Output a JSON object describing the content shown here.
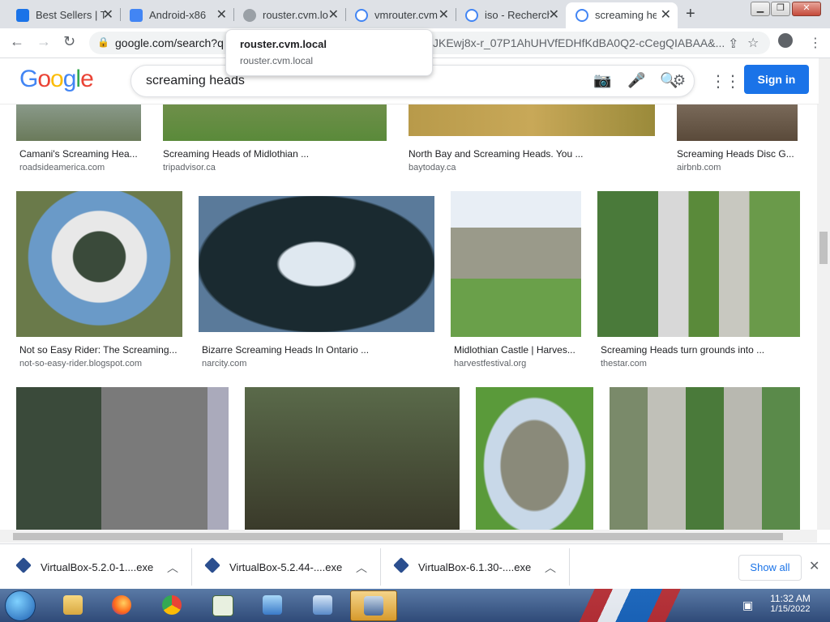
{
  "browser": {
    "tabs": [
      {
        "title": "Best Sellers | T",
        "favicon_color": "#1a73e8"
      },
      {
        "title": "Android-x86",
        "favicon_color": "#4285f4"
      },
      {
        "title": "rouster.cvm.lo",
        "favicon_color": "#9aa0a6"
      },
      {
        "title": "vmrouter.cvm",
        "favicon_color": "#4285f4"
      },
      {
        "title": "iso - Recherch",
        "favicon_color": "#4285f4"
      },
      {
        "title": "screaming he",
        "favicon_color": "#4285f4",
        "active": true
      }
    ],
    "url": "google.com/search?q",
    "url_tail": "JKEwj8x-r_07P1AhUHVfEDHfKdBA0Q2-cCegQIABAA&...",
    "tooltip": {
      "title": "rouster.cvm.local",
      "subtitle": "rouster.cvm.local"
    }
  },
  "google": {
    "logo": "Google",
    "query": "screaming heads",
    "signin_label": "Sign in"
  },
  "results": [
    {
      "caption": "Camani's Screaming Hea...",
      "source": "roadsideamerica.com"
    },
    {
      "caption": "Screaming Heads of Midlothian ...",
      "source": "tripadvisor.ca"
    },
    {
      "caption": "North Bay and Screaming Heads. You ...",
      "source": "baytoday.ca"
    },
    {
      "caption": "Screaming Heads Disc G...",
      "source": "airbnb.com"
    },
    {
      "caption": "Not so Easy Rider: The Screaming...",
      "source": "not-so-easy-rider.blogspot.com"
    },
    {
      "caption": "Bizarre Screaming Heads In Ontario ...",
      "source": "narcity.com"
    },
    {
      "caption": "Midlothian Castle | Harves...",
      "source": "harvestfestival.org"
    },
    {
      "caption": "Screaming Heads turn grounds into ...",
      "source": "thestar.com"
    },
    {
      "caption": "",
      "source": ""
    },
    {
      "caption": "",
      "source": ""
    },
    {
      "caption": "",
      "source": ""
    },
    {
      "caption": "",
      "source": ""
    }
  ],
  "downloads": {
    "items": [
      "VirtualBox-5.2.0-1....exe",
      "VirtualBox-5.2.44-....exe",
      "VirtualBox-6.1.30-....exe"
    ],
    "show_all_label": "Show all"
  },
  "taskbar": {
    "time": "11:32 AM",
    "date": "1/15/2022"
  }
}
